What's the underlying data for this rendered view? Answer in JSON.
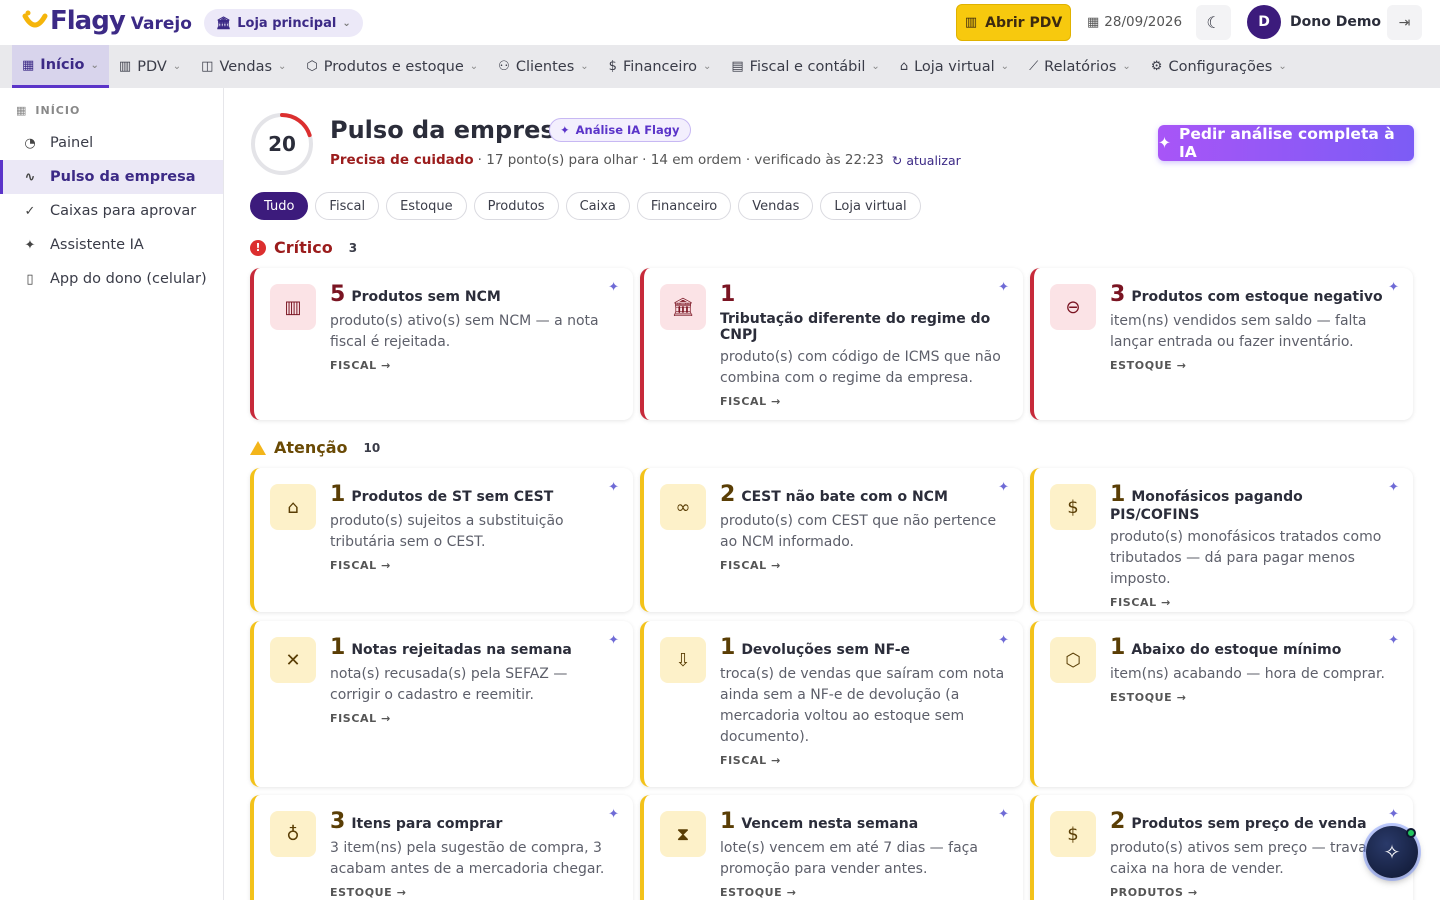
{
  "topbar": {
    "logo_word": "Flagy",
    "logo_sub": "Varejo",
    "store": "Loja principal",
    "pdv_button": "Abrir PDV",
    "date": "28/09/2026",
    "avatar_initial": "D",
    "user_name": "Dono Demo"
  },
  "nav": [
    {
      "label": "Início",
      "icon": "grid-icon"
    },
    {
      "label": "PDV",
      "icon": "barcode-icon"
    },
    {
      "label": "Vendas",
      "icon": "bag-icon"
    },
    {
      "label": "Produtos e estoque",
      "icon": "box-icon"
    },
    {
      "label": "Clientes",
      "icon": "users-icon"
    },
    {
      "label": "Financeiro",
      "icon": "money-icon"
    },
    {
      "label": "Fiscal e contábil",
      "icon": "receipt-icon"
    },
    {
      "label": "Loja virtual",
      "icon": "store-icon"
    },
    {
      "label": "Relatórios",
      "icon": "chart-icon"
    },
    {
      "label": "Configurações",
      "icon": "gear-icon"
    }
  ],
  "sidebar": {
    "heading": "INÍCIO",
    "items": [
      {
        "label": "Painel"
      },
      {
        "label": "Pulso da empresa"
      },
      {
        "label": "Caixas para aprovar"
      },
      {
        "label": "Assistente IA"
      },
      {
        "label": "App do dono (celular)"
      }
    ]
  },
  "pulse": {
    "score": "20",
    "score_fraction": 0.2,
    "title": "Pulso da empresa",
    "ai_badge": "Análise IA Flagy",
    "status": "Precisa de cuidado",
    "summary": "· 17 ponto(s) para olhar · 14 em ordem · verificado às 22:23",
    "refresh": "atualizar",
    "ai_button": "Pedir análise completa à IA"
  },
  "filters": [
    "Tudo",
    "Fiscal",
    "Estoque",
    "Produtos",
    "Caixa",
    "Financeiro",
    "Vendas",
    "Loja virtual"
  ],
  "sections": {
    "critical": {
      "label": "Crítico",
      "count": "3"
    },
    "attention": {
      "label": "Atenção",
      "count": "10"
    }
  },
  "critical_cards": [
    {
      "num": "5",
      "title": "Produtos sem NCM",
      "desc": "produto(s) ativo(s) sem NCM — a nota fiscal é rejeitada.",
      "link": "FISCAL →",
      "icon": "barcode-icon"
    },
    {
      "num": "1",
      "title": "Tributação diferente do regime do CNPJ",
      "desc": "produto(s) com código de ICMS que não combina com o regime da empresa.",
      "link": "FISCAL →",
      "icon": "bank-icon"
    },
    {
      "num": "3",
      "title": "Produtos com estoque negativo",
      "desc": "item(ns) vendidos sem saldo — falta lançar entrada ou fazer inventário.",
      "link": "ESTOQUE →",
      "icon": "minus-circle-icon"
    }
  ],
  "attention_cards": [
    {
      "num": "1",
      "title": "Produtos de ST sem CEST",
      "desc": "produto(s) sujeitos a substituição tributária sem o CEST.",
      "link": "FISCAL →",
      "icon": "tag-icon"
    },
    {
      "num": "2",
      "title": "CEST não bate com o NCM",
      "desc": "produto(s) com CEST que não pertence ao NCM informado.",
      "link": "FISCAL →",
      "icon": "link-icon"
    },
    {
      "num": "1",
      "title": "Monofásicos pagando PIS/COFINS",
      "desc": "produto(s) monofásicos tratados como tributados — dá para pagar menos imposto.",
      "link": "FISCAL →",
      "icon": "money-icon"
    },
    {
      "num": "1",
      "title": "Notas rejeitadas na semana",
      "desc": "nota(s) recusada(s) pela SEFAZ — corrigir o cadastro e reemitir.",
      "link": "FISCAL →",
      "icon": "file-x-icon"
    },
    {
      "num": "1",
      "title": "Devoluções sem NF-e",
      "desc": "troca(s) de vendas que saíram com nota ainda sem a NF-e de devolução (a mercadoria voltou ao estoque sem documento).",
      "link": "FISCAL →",
      "icon": "file-down-icon"
    },
    {
      "num": "1",
      "title": "Abaixo do estoque mínimo",
      "desc": "item(ns) acabando — hora de comprar.",
      "link": "ESTOQUE →",
      "icon": "package-icon"
    },
    {
      "num": "3",
      "title": "Itens para comprar",
      "desc": "3 item(ns) pela sugestão de compra, 3 acabam antes de a mercadoria chegar.",
      "link": "ESTOQUE →",
      "icon": "lightbulb-icon"
    },
    {
      "num": "1",
      "title": "Vencem nesta semana",
      "desc": "lote(s) vencem em até 7 dias — faça promoção para vender antes.",
      "link": "ESTOQUE →",
      "icon": "hourglass-icon"
    },
    {
      "num": "2",
      "title": "Produtos sem preço de venda",
      "desc": "produto(s) ativos sem preço — travam caixa na hora de vender.",
      "link": "PRODUTOS →",
      "icon": "dollar-icon"
    }
  ]
}
